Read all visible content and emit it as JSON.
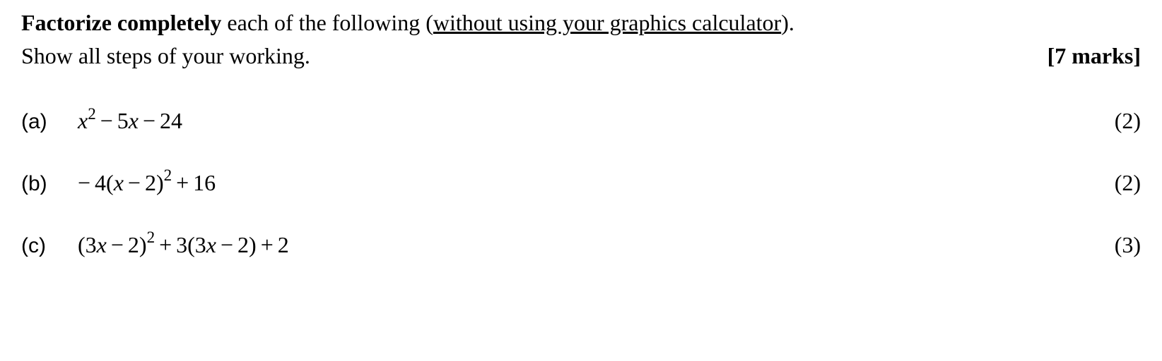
{
  "instruction": {
    "bold_lead": "Factorize completely",
    "middle": " each of the following (",
    "underlined": "without using your graphics calculator",
    "end": ").",
    "line2": "Show all steps of your working.",
    "total_marks": "[7 marks]"
  },
  "problems": [
    {
      "label": "(a)",
      "expression_html": "<span class='math'>x<span class='sup'>2</span><span class='op'>−</span><span class='num'>5</span>x<span class='op'>−</span><span class='num'>24</span></span>",
      "expression_plain": "x² − 5x − 24",
      "marks": "(2)"
    },
    {
      "label": "(b)",
      "expression_html": "<span class='math'><span class='op' style='margin-left:0'>−</span><span class='num'>4(</span>x<span class='op'>−</span><span class='num'>2)</span><span class='sup'>2</span><span class='op'>+</span><span class='num'>16</span></span>",
      "expression_plain": "−4(x − 2)² + 16",
      "marks": "(2)"
    },
    {
      "label": "(c)",
      "expression_html": "<span class='math'><span class='num'>(3</span>x<span class='op'>−</span><span class='num'>2)</span><span class='sup'>2</span><span class='op'>+</span><span class='num'>3(3</span>x<span class='op'>−</span><span class='num'>2)</span><span class='op'>+</span><span class='num'>2</span></span>",
      "expression_plain": "(3x − 2)² + 3(3x − 2) + 2",
      "marks": "(3)"
    }
  ]
}
